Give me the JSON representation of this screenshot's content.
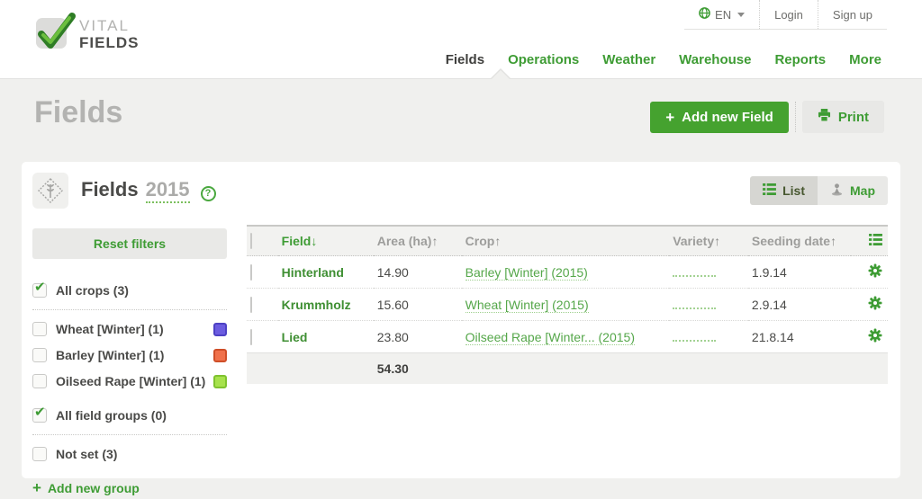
{
  "brand": {
    "line1": "VITAL",
    "line2": "FIELDS"
  },
  "utility": {
    "language": "EN",
    "login_label": "Login",
    "signup_label": "Sign up"
  },
  "nav": {
    "fields": "Fields",
    "operations": "Operations",
    "weather": "Weather",
    "warehouse": "Warehouse",
    "reports": "Reports",
    "more": "More"
  },
  "page": {
    "title": "Fields",
    "plus_glyph": "+",
    "add_field_label": "Add new Field",
    "print_label": "Print"
  },
  "card": {
    "title": "Fields",
    "year": "2015",
    "help_glyph": "?",
    "list_label": "List",
    "map_label": "Map"
  },
  "filters": {
    "reset_label": "Reset filters",
    "check_glyph": "✔",
    "plus_glyph": "+",
    "all_crops_label": "All crops (3)",
    "crops": [
      {
        "label": "Wheat [Winter] (1)",
        "color": "#6b5ce0",
        "border": "#4d41c4"
      },
      {
        "label": "Barley [Winter] (1)",
        "color": "#f0714b",
        "border": "#cf4e28"
      },
      {
        "label": "Oilseed Rape [Winter] (1)",
        "color": "#a7e24c",
        "border": "#7fc32f"
      }
    ],
    "all_groups_label": "All field groups (0)",
    "not_set_label": "Not set (3)",
    "add_group_label": "Add new group"
  },
  "table": {
    "headers": {
      "field": "Field",
      "area": "Area (ha)",
      "crop": "Crop",
      "variety": "Variety",
      "seeding": "Seeding date"
    },
    "sort": {
      "down_glyph": "↓",
      "up_glyph": "↑"
    },
    "rows": [
      {
        "field": "Hinterland",
        "area": "14.90",
        "crop": "Barley [Winter] (2015)",
        "seeding": "1.9.14"
      },
      {
        "field": "Krummholz",
        "area": "15.60",
        "crop": "Wheat [Winter] (2015)",
        "seeding": "2.9.14"
      },
      {
        "field": "Lied",
        "area": "23.80",
        "crop": "Oilseed Rape [Winter... (2015)",
        "seeding": "21.8.14"
      }
    ],
    "total_area": "54.30"
  },
  "colors": {
    "brand_green": "#3e9c34",
    "link_green": "#55a74a",
    "button_green": "#45a22f"
  }
}
